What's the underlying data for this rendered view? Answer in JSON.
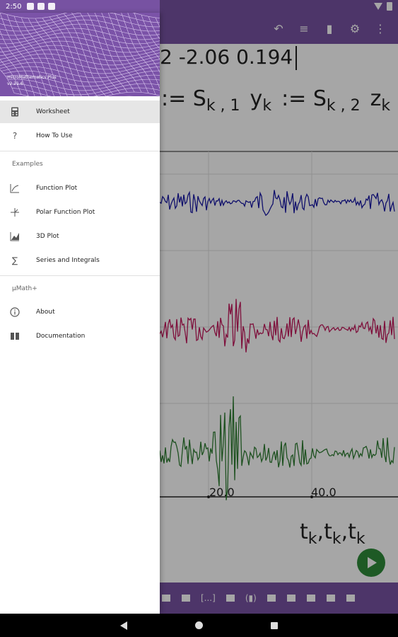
{
  "status_bar": {
    "time": "2:50"
  },
  "worksheet": {
    "formula_text": "2   -2.06   0.194",
    "assign_parts": [
      {
        "pre": ":= S",
        "sub": "k , 1"
      },
      {
        "pre": "y",
        "sub": "k"
      },
      {
        "pre": ":= S",
        "sub": "k , 2"
      },
      {
        "pre": "z",
        "sub": "k"
      },
      {
        "pre": ":",
        "sub": ""
      }
    ],
    "x_tick_labels": [
      "20.0",
      "40.0"
    ],
    "t_label": "t",
    "t_sub": "k",
    "keybar_keys": [
      "[...]"
    ]
  },
  "drawer": {
    "app_name": "microMathematics Plus",
    "app_version": "v2.21.6",
    "items": [
      {
        "label": "Worksheet",
        "icon": "calculator-icon",
        "selected": true
      },
      {
        "label": "How To Use",
        "icon": "question-icon",
        "selected": false
      }
    ],
    "section_examples": "Examples",
    "examples": [
      {
        "label": "Function Plot",
        "icon": "function-plot-icon"
      },
      {
        "label": "Polar Function Plot",
        "icon": "polar-plot-icon"
      },
      {
        "label": "3D Plot",
        "icon": "3d-plot-icon"
      },
      {
        "label": "Series and Integrals",
        "icon": "sigma-icon"
      }
    ],
    "section_umath": "µMath+",
    "umath": [
      {
        "label": "About",
        "icon": "info-icon"
      },
      {
        "label": "Documentation",
        "icon": "book-icon"
      }
    ]
  },
  "colors": {
    "primary": "#7752a2",
    "series_x": "#1a1aa6",
    "series_y": "#c2185b",
    "series_z": "#2e7d32",
    "fab": "#2e8b3a"
  }
}
